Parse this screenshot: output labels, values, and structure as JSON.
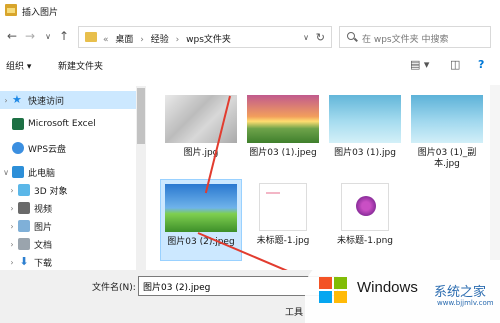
{
  "window": {
    "title": "插入图片"
  },
  "address": {
    "back": "←",
    "forward": "→",
    "recent": "∨",
    "up": "↑",
    "crumbs": [
      "«",
      "桌面",
      "›",
      "经验",
      "›",
      "wps文件夹"
    ],
    "dropdown": "∨",
    "refresh": "↻"
  },
  "search": {
    "placeholder": "在 wps文件夹 中搜索"
  },
  "toolbar": {
    "organize": "组织 ▾",
    "new_folder": "新建文件夹",
    "view_icon": "▤ ▾",
    "pane_icon": "◫",
    "help_icon": "?"
  },
  "nav": {
    "items": [
      {
        "label": "快速访问",
        "arrow": "›"
      },
      {
        "label": "Microsoft Excel",
        "arrow": ""
      },
      {
        "label": "WPS云盘",
        "arrow": ""
      },
      {
        "label": "此电脑",
        "arrow": "∨"
      },
      {
        "label": "3D 对象",
        "arrow": "›"
      },
      {
        "label": "视频",
        "arrow": "›"
      },
      {
        "label": "图片",
        "arrow": "›"
      },
      {
        "label": "文档",
        "arrow": "›"
      },
      {
        "label": "下载",
        "arrow": "›"
      }
    ]
  },
  "files": [
    {
      "name": "图片.jpg"
    },
    {
      "name": "图片03 (1).jpeg"
    },
    {
      "name": "图片03 (1).jpg"
    },
    {
      "name": "图片03 (1)_副本.jpg"
    },
    {
      "name": "图片03 (2).jpeg"
    },
    {
      "name": "未标题-1.jpg"
    },
    {
      "name": "未标题-1.png"
    }
  ],
  "bottom": {
    "filename_label": "文件名(N):",
    "filename_value": "图片03 (2).jpeg",
    "tools_label": "工具"
  },
  "watermark": {
    "text": "Windows",
    "text2": "系统之家",
    "url": "www.bjjmlv.com"
  },
  "colors": {
    "selection": "#cce8ff",
    "accent": "#0078d7",
    "arrow": "#e23c2f"
  }
}
